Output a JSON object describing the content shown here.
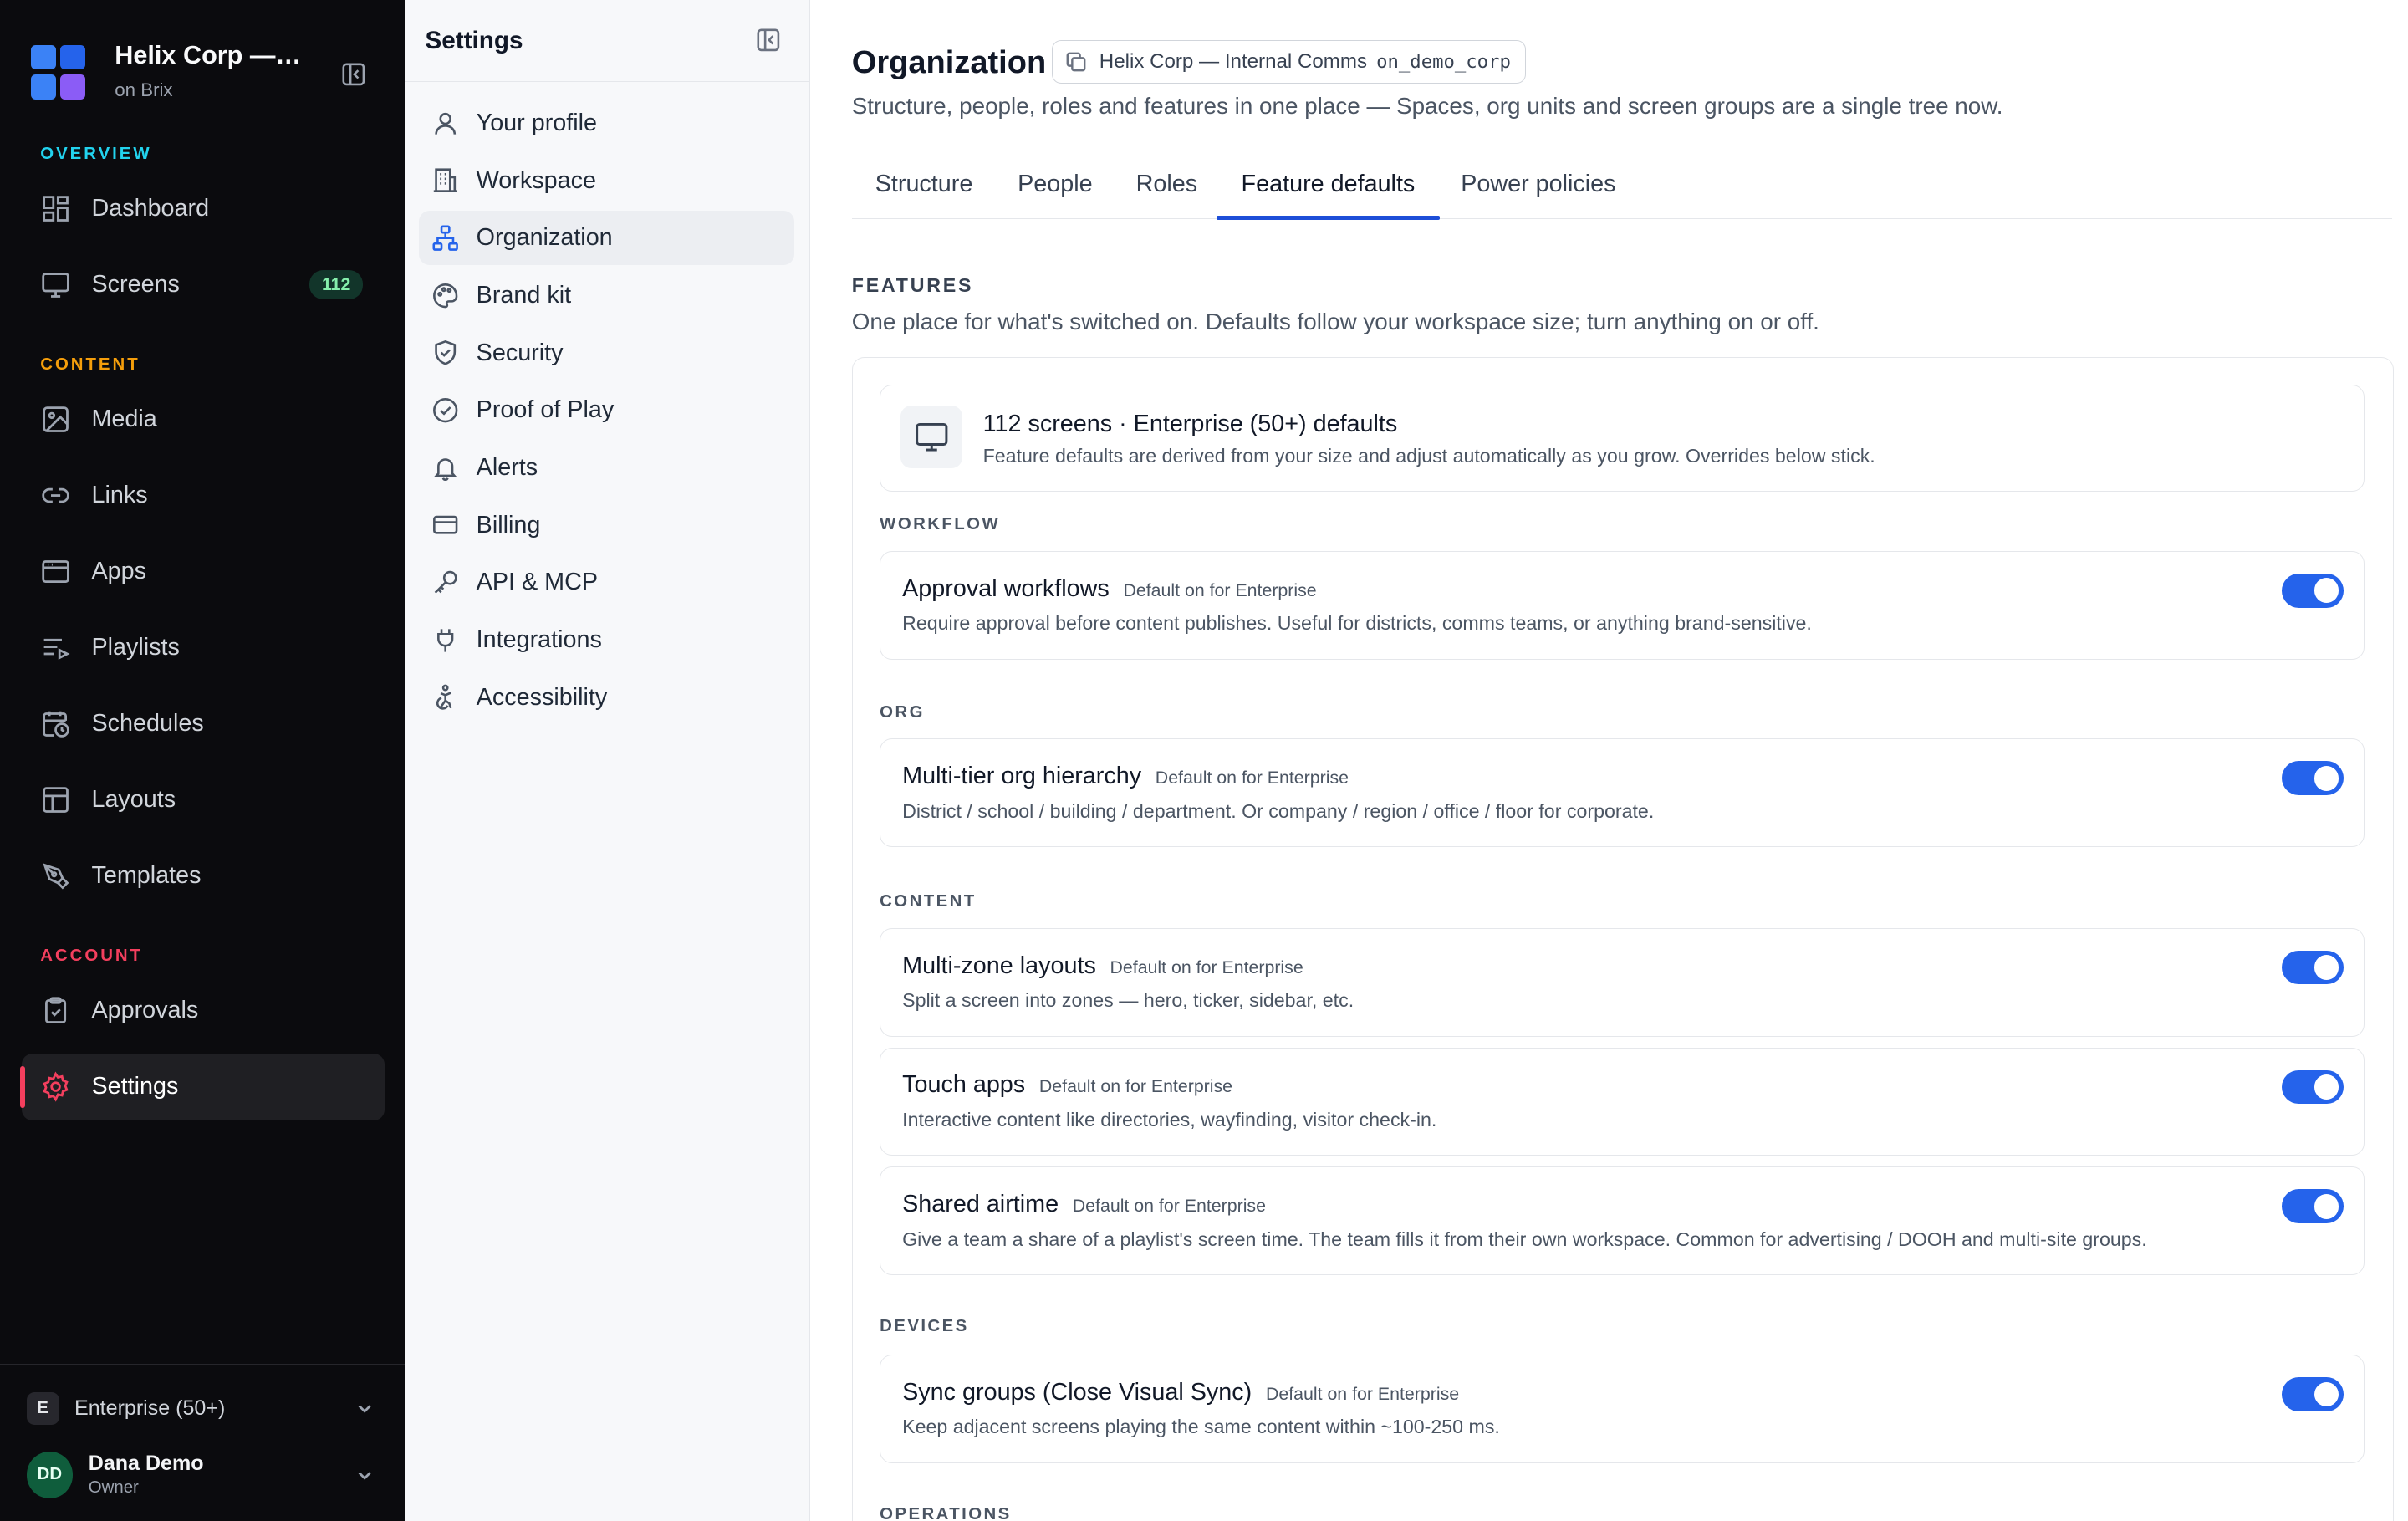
{
  "brand": {
    "title": "Helix Corp — I...",
    "subtitle": "on Brix",
    "logo_colors": [
      "#3b82f6",
      "#2563eb",
      "#3b82f6",
      "#8b5cf6"
    ]
  },
  "sidebar": {
    "sections": [
      {
        "label": "OVERVIEW",
        "color": "#22d3ee"
      },
      {
        "label": "CONTENT",
        "color": "#f59e0b"
      },
      {
        "label": "ACCOUNT",
        "color": "#f43f5e"
      }
    ],
    "items": [
      {
        "label": "Dashboard",
        "icon": "dashboard-icon"
      },
      {
        "label": "Screens",
        "icon": "monitor-icon",
        "badge": "112"
      },
      {
        "label": "Media",
        "icon": "image-icon"
      },
      {
        "label": "Links",
        "icon": "link-icon"
      },
      {
        "label": "Apps",
        "icon": "app-window-icon"
      },
      {
        "label": "Playlists",
        "icon": "playlist-icon"
      },
      {
        "label": "Schedules",
        "icon": "calendar-clock-icon"
      },
      {
        "label": "Layouts",
        "icon": "layout-icon"
      },
      {
        "label": "Templates",
        "icon": "pen-tool-icon"
      },
      {
        "label": "Approvals",
        "icon": "clipboard-check-icon"
      },
      {
        "label": "Settings",
        "icon": "gear-icon",
        "active": true
      }
    ],
    "plan": {
      "badge": "E",
      "label": "Enterprise (50+)"
    },
    "user": {
      "initials": "DD",
      "name": "Dana Demo",
      "role": "Owner"
    }
  },
  "settings_nav": {
    "title": "Settings",
    "items": [
      {
        "label": "Your profile",
        "icon": "user-icon"
      },
      {
        "label": "Workspace",
        "icon": "building-icon"
      },
      {
        "label": "Organization",
        "icon": "org-tree-icon",
        "active": true
      },
      {
        "label": "Brand kit",
        "icon": "palette-icon"
      },
      {
        "label": "Security",
        "icon": "shield-icon"
      },
      {
        "label": "Proof of Play",
        "icon": "check-circle-icon"
      },
      {
        "label": "Alerts",
        "icon": "bell-icon"
      },
      {
        "label": "Billing",
        "icon": "credit-card-icon"
      },
      {
        "label": "API & MCP",
        "icon": "key-icon"
      },
      {
        "label": "Integrations",
        "icon": "plug-icon"
      },
      {
        "label": "Accessibility",
        "icon": "accessibility-icon"
      }
    ]
  },
  "main": {
    "title": "Organization",
    "org_chip": {
      "name": "Helix Corp — Internal Comms",
      "id": "on_demo_corp",
      "icon": "copy-icon"
    },
    "subtitle": "Structure, people, roles and features in one place — Spaces, org units and screen groups are a single tree now.",
    "tabs": [
      {
        "label": "Structure"
      },
      {
        "label": "People"
      },
      {
        "label": "Roles"
      },
      {
        "label": "Feature defaults",
        "active": true
      },
      {
        "label": "Power policies"
      }
    ],
    "features": {
      "label": "FEATURES",
      "description": "One place for what's switched on. Defaults follow your workspace size; turn anything on or off.",
      "summary": {
        "title": "112 screens · Enterprise (50+) defaults",
        "text": "Feature defaults are derived from your size and adjust automatically as you grow. Overrides below stick."
      },
      "groups": [
        {
          "label": "WORKFLOW"
        },
        {
          "label": "ORG"
        },
        {
          "label": "CONTENT"
        },
        {
          "label": "DEVICES"
        },
        {
          "label": "OPERATIONS"
        }
      ],
      "items": [
        {
          "name": "Approval workflows",
          "default": "Default on for Enterprise",
          "description": "Require approval before content publishes. Useful for districts, comms teams, or anything brand-sensitive.",
          "enabled": true
        },
        {
          "name": "Multi-tier org hierarchy",
          "default": "Default on for Enterprise",
          "description": "District / school / building / department. Or company / region / office / floor for corporate.",
          "enabled": true
        },
        {
          "name": "Multi-zone layouts",
          "default": "Default on for Enterprise",
          "description": "Split a screen into zones — hero, ticker, sidebar, etc.",
          "enabled": true
        },
        {
          "name": "Touch apps",
          "default": "Default on for Enterprise",
          "description": "Interactive content like directories, wayfinding, visitor check-in.",
          "enabled": true
        },
        {
          "name": "Shared airtime",
          "default": "Default on for Enterprise",
          "description": "Give a team a share of a playlist's screen time. The team fills it from their own workspace. Common for advertising / DOOH and multi-site groups.",
          "enabled": true
        },
        {
          "name": "Sync groups (Close Visual Sync)",
          "default": "Default on for Enterprise",
          "description": "Keep adjacent screens playing the same content within ~100-250 ms.",
          "enabled": true
        }
      ]
    }
  },
  "colors": {
    "sidebar_bg": "#0b0b0e",
    "accent_blue": "#2563eb",
    "active_red": "#f43f5e",
    "badge_green": "#86efac"
  }
}
